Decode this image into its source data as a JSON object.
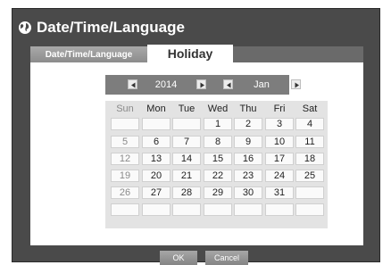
{
  "window": {
    "title": "Date/Time/Language",
    "icon": "globe-icon"
  },
  "tabs": [
    {
      "label": "Date/Time/Language",
      "active": false
    },
    {
      "label": "Holiday",
      "active": true
    }
  ],
  "navigator": {
    "year": "2014",
    "month": "Jan",
    "icons": [
      "prev-year-arrow-icon",
      "next-year-arrow-icon",
      "prev-month-arrow-icon",
      "next-month-arrow-icon"
    ]
  },
  "calendar": {
    "weekdays": [
      "Sun",
      "Mon",
      "Tue",
      "Wed",
      "Thu",
      "Fri",
      "Sat"
    ],
    "weeks": [
      [
        "",
        "",
        "",
        "1",
        "2",
        "3",
        "4"
      ],
      [
        "5",
        "6",
        "7",
        "8",
        "9",
        "10",
        "11"
      ],
      [
        "12",
        "13",
        "14",
        "15",
        "16",
        "17",
        "18"
      ],
      [
        "19",
        "20",
        "21",
        "22",
        "23",
        "24",
        "25"
      ],
      [
        "26",
        "27",
        "28",
        "29",
        "30",
        "31",
        ""
      ],
      [
        "",
        "",
        "",
        "",
        "",
        "",
        ""
      ]
    ]
  },
  "footer": {
    "ok_label": "OK",
    "cancel_label": "Cancel"
  },
  "colors": {
    "window_bg": "#4a4a4a",
    "panel_bg": "#ffffff",
    "nav_bar_bg": "#7d7d7d",
    "calendar_bg": "#e3e3e3",
    "sunday_text": "#8a8a8a"
  }
}
